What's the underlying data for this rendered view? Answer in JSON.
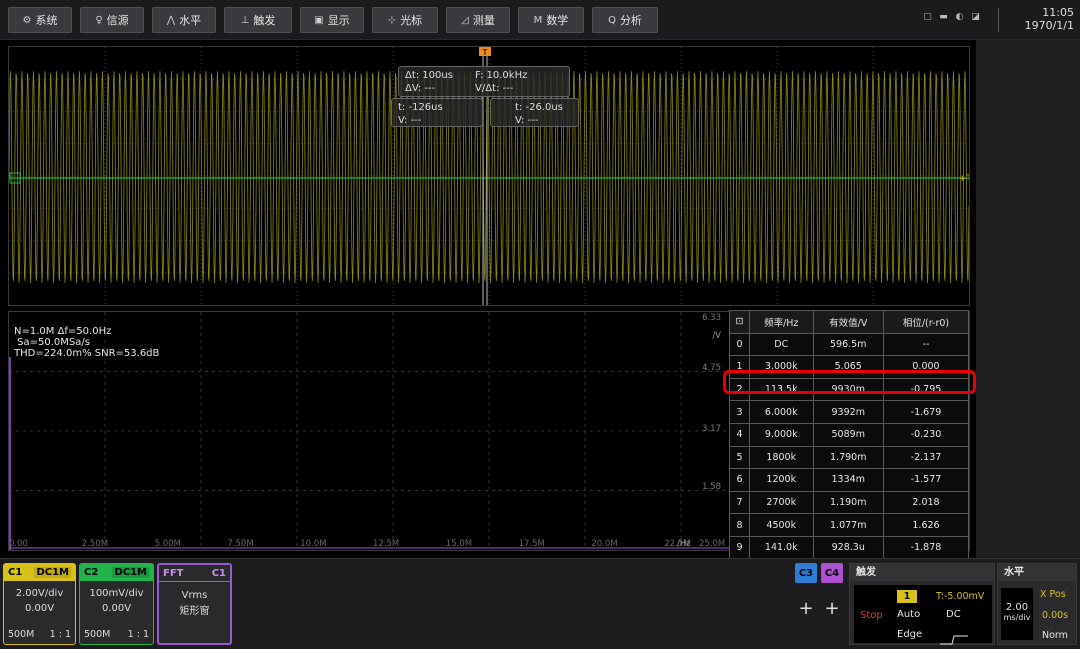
{
  "toolbar": {
    "buttons": [
      {
        "icon": "⚙",
        "label": "系统"
      },
      {
        "icon": "♀",
        "label": "信源"
      },
      {
        "icon": "⋀",
        "label": "水平"
      },
      {
        "icon": "⊥",
        "label": "触发"
      },
      {
        "icon": "▣",
        "label": "显示"
      },
      {
        "icon": "⊹",
        "label": "光标"
      },
      {
        "icon": "◿",
        "label": "测量"
      },
      {
        "icon": "M",
        "label": "数学"
      },
      {
        "icon": "Q",
        "label": "分析"
      }
    ],
    "time": "11:05",
    "date": "1970/1/1"
  },
  "cursor": {
    "trigger_marker": "T",
    "delta_t": "Δt: 100us",
    "freq": "F: 10.0kHz",
    "delta_v": "ΔV: ---",
    "dv_dt": "V/Δt: ---",
    "a_t": "t: -126us",
    "a_v": "V: ---",
    "b_t": "t: -26.0us",
    "b_v": "V: ---"
  },
  "fft": {
    "info": [
      "N=1.0M Δf=50.0Hz",
      " Sa=50.0MSa/s",
      "THD=224.0m% SNR=53.6dB"
    ],
    "y_ticks": [
      "6.33",
      "4.75",
      "3.17",
      "1.58"
    ],
    "y_unit": "/V",
    "x_ticks": [
      "0.00",
      "2.50M",
      "5.00M",
      "7.50M",
      "10.0M",
      "12.5M",
      "15.0M",
      "17.5M",
      "20.0M",
      "22.5M",
      "25.0M"
    ],
    "x_unit": "/Hz"
  },
  "harmonics": {
    "headers": [
      "频率/Hz",
      "有效值/V",
      "相位/(r-r0)"
    ],
    "rows": [
      [
        "0",
        "DC",
        "596.5m",
        "--"
      ],
      [
        "1",
        "3.000k",
        "5.065",
        "0.000"
      ],
      [
        "2",
        "113.5k",
        "9930m",
        "-0.795"
      ],
      [
        "3",
        "6.000k",
        "9392m",
        "-1.679"
      ],
      [
        "4",
        "9.000k",
        "5089m",
        "-0.230"
      ],
      [
        "5",
        "1800k",
        "1.790m",
        "-2.137"
      ],
      [
        "6",
        "1200k",
        "1334m",
        "-1.577"
      ],
      [
        "7",
        "2700k",
        "1.190m",
        "2.018"
      ],
      [
        "8",
        "4500k",
        "1.077m",
        "1.626"
      ],
      [
        "9",
        "141.0k",
        "928.3u",
        "-1.878"
      ]
    ],
    "highlighted_row": 2
  },
  "channels": {
    "c1": {
      "name": "C1",
      "coupling": "DC1M",
      "scale": "2.00V/div",
      "offset": "0.00V",
      "bw": "500M",
      "probe": "1 : 1",
      "color": "#d8c11a"
    },
    "c2": {
      "name": "C2",
      "coupling": "DC1M",
      "scale": "100mV/div",
      "offset": "0.00V",
      "bw": "500M",
      "probe": "1 : 1",
      "color": "#22b34a"
    },
    "fft": {
      "name": "FFT",
      "source": "C1",
      "mode": "Vrms",
      "window": "矩形窗",
      "color": "#9b59d6"
    },
    "c3": {
      "name": "C3",
      "color": "#2b7fd8"
    },
    "c4": {
      "name": "C4",
      "color": "#b04fd0"
    }
  },
  "trigger": {
    "title": "触发",
    "source": "1",
    "level": "T:-5.00mV",
    "state": "Stop",
    "mode": "Auto",
    "coupling": "DC",
    "type": "Edge"
  },
  "horizontal": {
    "title": "水平",
    "scale": "2.00",
    "unit": "ms/div",
    "xpos_label": "X Pos",
    "xpos": "0.00s",
    "mode": "Norm"
  }
}
